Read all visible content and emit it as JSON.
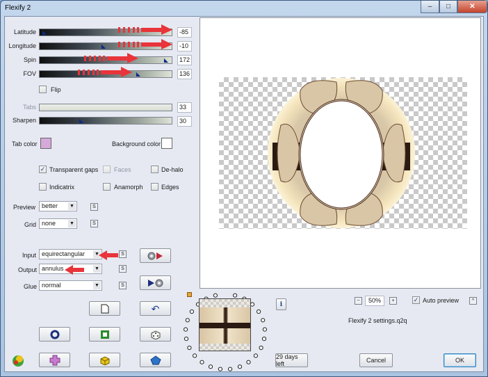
{
  "window": {
    "title": "Flexify 2",
    "min_glyph": "–",
    "max_glyph": "□",
    "close_glyph": "✕"
  },
  "sliders": [
    {
      "label": "Latitude",
      "value": "-85",
      "position": 0.03,
      "enabled": true
    },
    {
      "label": "Longitude",
      "value": "-10",
      "position": 0.47,
      "enabled": true
    },
    {
      "label": "Spin",
      "value": "172",
      "position": 0.98,
      "enabled": true
    },
    {
      "label": "FOV",
      "value": "136",
      "position": 0.74,
      "enabled": true
    },
    {
      "label": "Tabs",
      "value": "33",
      "position": 0.0,
      "enabled": false
    },
    {
      "label": "Sharpen",
      "value": "30",
      "position": 0.3,
      "enabled": true
    }
  ],
  "flip": {
    "label": "Flip",
    "checked": false
  },
  "tab_color": {
    "label": "Tab color",
    "color": "#d7a9da"
  },
  "background_color": {
    "label": "Background color",
    "color": "#ffffff"
  },
  "options": [
    {
      "label": "Transparent gaps",
      "checked": true,
      "enabled": true
    },
    {
      "label": "Faces",
      "checked": false,
      "enabled": false
    },
    {
      "label": "De-halo",
      "checked": false,
      "enabled": true
    },
    {
      "label": "Indicatrix",
      "checked": false,
      "enabled": true
    },
    {
      "label": "Anamorph",
      "checked": false,
      "enabled": true
    },
    {
      "label": "Edges",
      "checked": false,
      "enabled": true
    }
  ],
  "preview_select": {
    "label": "Preview",
    "value": "better"
  },
  "grid_select": {
    "label": "Grid",
    "value": "none"
  },
  "input_select": {
    "label": "Input",
    "value": "equirectangular"
  },
  "output_select": {
    "label": "Output",
    "value": "annulus"
  },
  "glue_select": {
    "label": "Glue",
    "value": "normal"
  },
  "small_button_glyph": "S",
  "info_glyph": "i",
  "zoom": {
    "minus": "−",
    "value": "50%",
    "plus": "+"
  },
  "auto_preview": {
    "label": "Auto preview",
    "checked": true,
    "toggle_glyph": "^"
  },
  "settings_file": "Flexify 2 settings.q2q",
  "trial_button": "29 days left",
  "cancel_button": "Cancel",
  "ok_button": "OK",
  "colors": {
    "accent_arrow": "#e8343a",
    "slider_thumb": "#0b2a8a",
    "ring_outer": "#f6e9c8",
    "ring_dark": "#4a2a1a"
  }
}
